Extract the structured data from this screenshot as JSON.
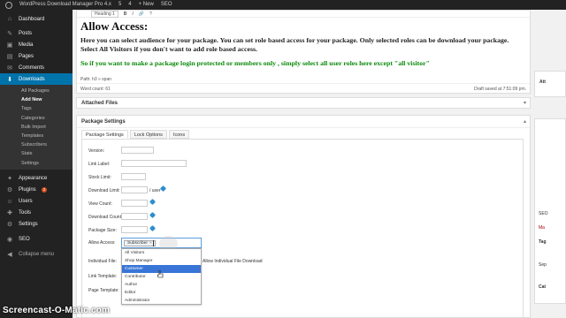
{
  "admin_bar": {
    "site_name": "WordPress Download Manager Pro 4.x",
    "updates_count": "5",
    "comments_count": "4",
    "new_label": "+ New",
    "seo_label": "SEO"
  },
  "sidebar": {
    "items": [
      {
        "label": "Dashboard",
        "icon": "dashboard-icon",
        "glyph": "⌂"
      },
      {
        "label": "Posts",
        "icon": "pin-icon",
        "glyph": "✎"
      },
      {
        "label": "Media",
        "icon": "media-icon",
        "glyph": "▣"
      },
      {
        "label": "Pages",
        "icon": "page-icon",
        "glyph": "▤"
      },
      {
        "label": "Comments",
        "icon": "comment-icon",
        "glyph": "✉"
      },
      {
        "label": "Downloads",
        "icon": "download-icon",
        "glyph": "⬇"
      }
    ],
    "downloads_submenu": [
      "All Packages",
      "Add New",
      "Tags",
      "Categories",
      "Bulk Import",
      "Templates",
      "Subscribers",
      "Stats",
      "Settings"
    ],
    "lower_items": [
      {
        "label": "Appearance",
        "icon": "brush-icon",
        "glyph": "✦"
      },
      {
        "label": "Plugins",
        "icon": "plug-icon",
        "glyph": "⚙",
        "badge": "2"
      },
      {
        "label": "Users",
        "icon": "user-icon",
        "glyph": "☺"
      },
      {
        "label": "Tools",
        "icon": "wrench-icon",
        "glyph": "✚"
      },
      {
        "label": "Settings",
        "icon": "settings-icon",
        "glyph": "⚙"
      },
      {
        "label": "SEO",
        "icon": "seo-icon",
        "glyph": "◉"
      },
      {
        "label": "Collapse menu",
        "icon": "collapse-icon",
        "glyph": "◀"
      }
    ]
  },
  "editor": {
    "format_select": "Heading 1",
    "heading": "Allow Access:",
    "paragraph": "Here you can select audience for your package. You can set role based access for your package. Only selected roles can be download your package. Select All Visitors if you don't want to add role based access.",
    "green_note": "So if you want to make a package login protected or members only , simply select all user roles here except \"all visitor\"",
    "path": "Path: h3 » span",
    "word_count": "Word count: 61",
    "draft_saved": "Draft saved at 7:51:09 pm."
  },
  "attached_files": {
    "title": "Attached Files"
  },
  "package_settings": {
    "title": "Package Settings",
    "tabs": [
      "Package Settings",
      "Lock Options",
      "Icons"
    ],
    "fields": {
      "version": "Version:",
      "link_label": "Link Label:",
      "stock_limit": "Stock Limit:",
      "download_limit": "Download Limit:",
      "download_limit_suffix": "/ user",
      "view_count": "View Count:",
      "download_count": "Download Count:",
      "package_size": "Package Size:",
      "allow_access": "Allow Access:",
      "individual_file": "Individual File:",
      "individual_file_checkbox": "Allow Individual File Download",
      "link_template": "Link Template:",
      "page_template": "Page Template:"
    },
    "allow_access_selected": "Subscriber",
    "role_options": [
      "All Visitors",
      "Shop Manager",
      "Customer",
      "Contributor",
      "Author",
      "Editor",
      "Administrator"
    ],
    "highlighted_option": "Customer"
  },
  "right_column": {
    "attributes_label": "Att",
    "tags_label": "Tag",
    "categories_label": "SEO",
    "mag_label": "Ma",
    "sep_label": "Sep",
    "cat_label": "Cat"
  },
  "watermark": "Screencast-O-Matic.com",
  "colors": {
    "accent": "#0073aa",
    "highlight": "#3875d7",
    "green_text": "#0a8a0a",
    "info_icon": "#2e8ecf"
  }
}
